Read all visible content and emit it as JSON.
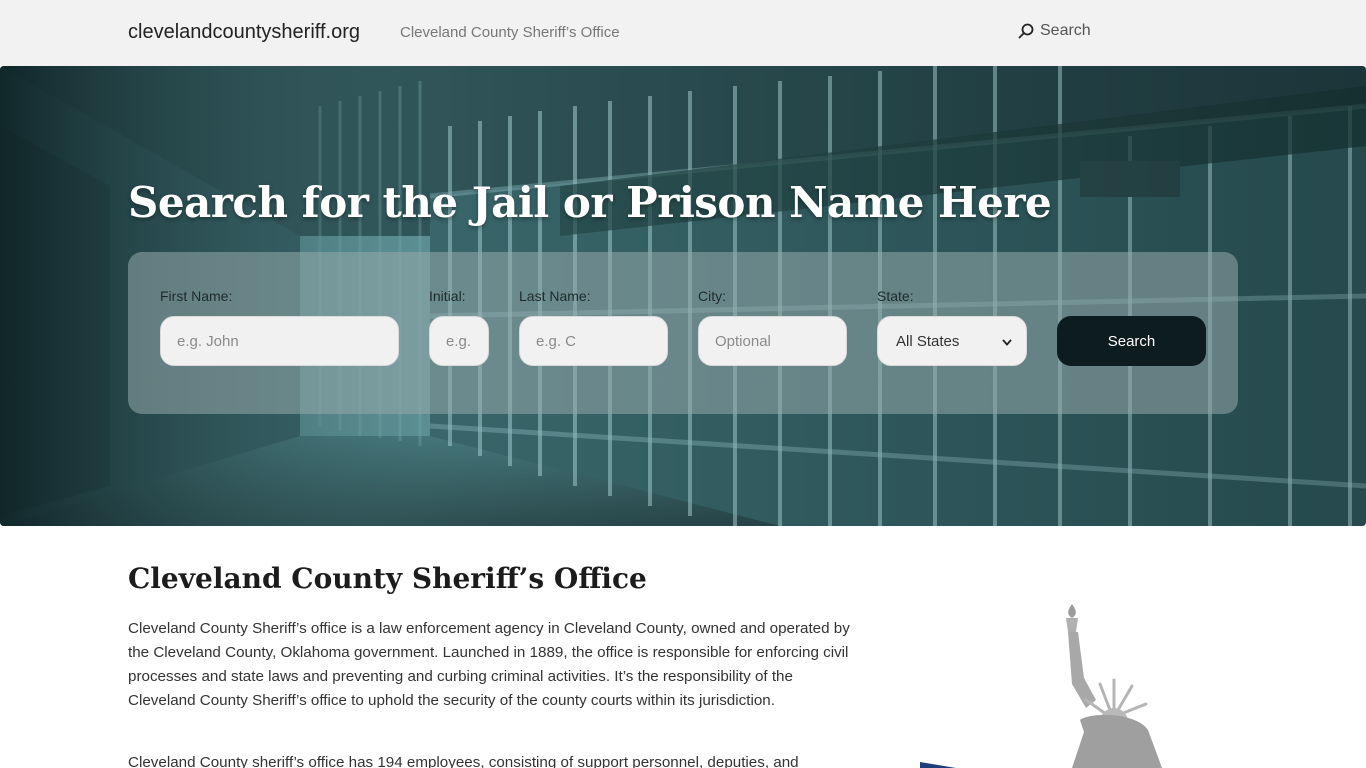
{
  "header": {
    "site_name": "clevelandcountysheriff.org",
    "tagline": "Cleveland County Sheriff’s Office",
    "search_label": "Search"
  },
  "hero": {
    "title": "Search for the Jail or Prison Name Here",
    "form": {
      "first_name": {
        "label": "First Name:",
        "placeholder": "e.g. John"
      },
      "initial": {
        "label": "Initial:",
        "placeholder": "e.g."
      },
      "last_name": {
        "label": "Last Name:",
        "placeholder": "e.g. C"
      },
      "city": {
        "label": "City:",
        "placeholder": "Optional"
      },
      "state": {
        "label": "State:",
        "selected": "All States"
      },
      "submit_label": "Search"
    }
  },
  "content": {
    "title": "Cleveland County Sheriff’s Office",
    "paragraphs": [
      "Cleveland County Sheriff’s office is a law enforcement agency in Cleveland County, owned and operated by the Cleveland County, Oklahoma government. Launched in 1889, the office is responsible for enforcing civil processes and state laws and preventing and curbing criminal activities. It’s the responsibility of the Cleveland County Sheriff’s office to uphold the security of the county courts within its jurisdiction.",
      "Cleveland County sheriff’s office has 194 employees, consisting of support personnel, deputies, and"
    ]
  },
  "colors": {
    "header_bg": "#f2f2f2",
    "hero_tint": "#2e6065",
    "button_bg": "#0c1c1f"
  },
  "icons": {
    "search": "search-icon",
    "select_arrow": "chevron-down-icon",
    "illustration": "statue-of-liberty-icon"
  }
}
